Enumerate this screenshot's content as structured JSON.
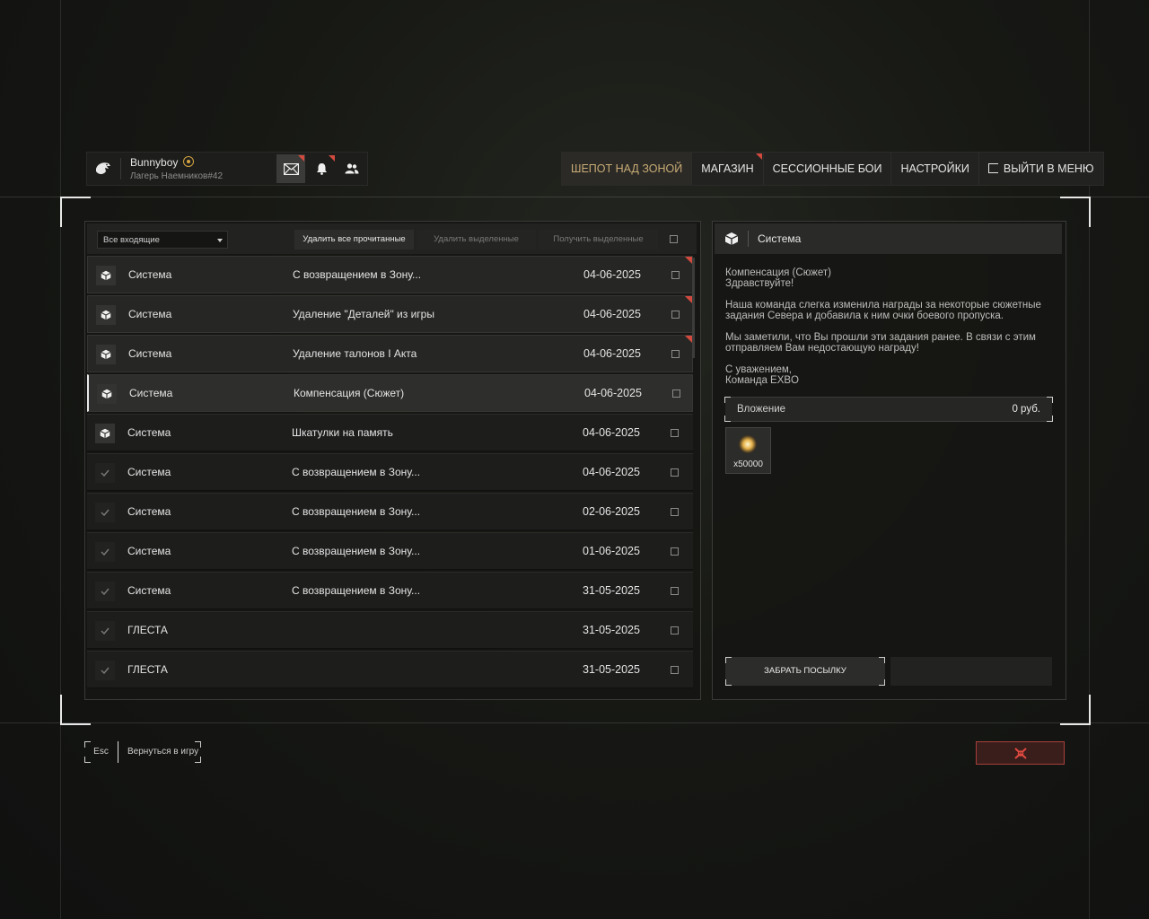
{
  "profile": {
    "username": "Bunnyboy",
    "subtitle": "Лагерь Наемников#42",
    "buttons": [
      {
        "icon": "mail-icon",
        "active": true,
        "notify": true
      },
      {
        "icon": "bell-icon",
        "active": false,
        "notify": true
      },
      {
        "icon": "friends-icon",
        "active": false,
        "notify": false
      }
    ]
  },
  "nav": {
    "items": [
      "ШЕПОТ НАД ЗОНОЙ",
      "МАГАЗИН",
      "СЕССИОННЫЕ БОИ",
      "НАСТРОЙКИ",
      "ВЫЙТИ В МЕНЮ"
    ],
    "active_index": 0,
    "notify_index": 1,
    "accent_color": "#c9ac76"
  },
  "toolbar": {
    "filter_value": "Все входящие",
    "delete_read": "Удалить все прочитанные",
    "delete_selected": "Удалить выделенные",
    "receive_selected": "Получить выделенные"
  },
  "messages": [
    {
      "sender": "Система",
      "subject": "С возвращением в Зону...",
      "date": "04-06-2025",
      "status": "unread",
      "icon": "package-icon"
    },
    {
      "sender": "Система",
      "subject": "Удаление \"Деталей\" из игры",
      "date": "04-06-2025",
      "status": "unread",
      "icon": "package-icon"
    },
    {
      "sender": "Система",
      "subject": "Удаление талонов I Акта",
      "date": "04-06-2025",
      "status": "unread",
      "icon": "package-icon"
    },
    {
      "sender": "Система",
      "subject": "Компенсация (Сюжет)",
      "date": "04-06-2025",
      "status": "selected",
      "icon": "package-icon"
    },
    {
      "sender": "Система",
      "subject": "Шкатулки на память",
      "date": "04-06-2025",
      "status": "opened",
      "icon": "package-icon"
    },
    {
      "sender": "Система",
      "subject": "С возвращением в Зону...",
      "date": "04-06-2025",
      "status": "read",
      "icon": "check-icon"
    },
    {
      "sender": "Система",
      "subject": "С возвращением в Зону...",
      "date": "02-06-2025",
      "status": "read",
      "icon": "check-icon"
    },
    {
      "sender": "Система",
      "subject": "С возвращением в Зону...",
      "date": "01-06-2025",
      "status": "read",
      "icon": "check-icon"
    },
    {
      "sender": "Система",
      "subject": "С возвращением в Зону...",
      "date": "31-05-2025",
      "status": "read",
      "icon": "check-icon"
    },
    {
      "sender": "ГЛЕСТА",
      "subject": "",
      "date": "31-05-2025",
      "status": "read",
      "icon": "check-icon"
    },
    {
      "sender": "ГЛЕСТА",
      "subject": "",
      "date": "31-05-2025",
      "status": "read",
      "icon": "check-icon"
    }
  ],
  "detail": {
    "sender": "Система",
    "lines": [
      [
        "Компенсация (Сюжет)",
        "Здравствуйте!"
      ],
      [
        "Наша команда слегка изменила награды за некоторые сюжетные",
        "задания Севера и добавила к ним очки боевого пропуска."
      ],
      [
        "Мы заметили, что Вы прошли эти задания ранее. В связи с этим",
        "отправляем Вам недостающую награду!"
      ],
      [
        "С уважением,",
        "Команда EXBO"
      ]
    ],
    "attachment_label": "Вложение",
    "attachment_value": "0 руб.",
    "item_qty": "x50000",
    "claim_button": "ЗАБРАТЬ ПОСЫЛКУ"
  },
  "footer": {
    "esc_key": "Esc",
    "back_label": "Вернуться в игру",
    "close_icon": "skull-icon",
    "danger_color": "#a6403a"
  }
}
